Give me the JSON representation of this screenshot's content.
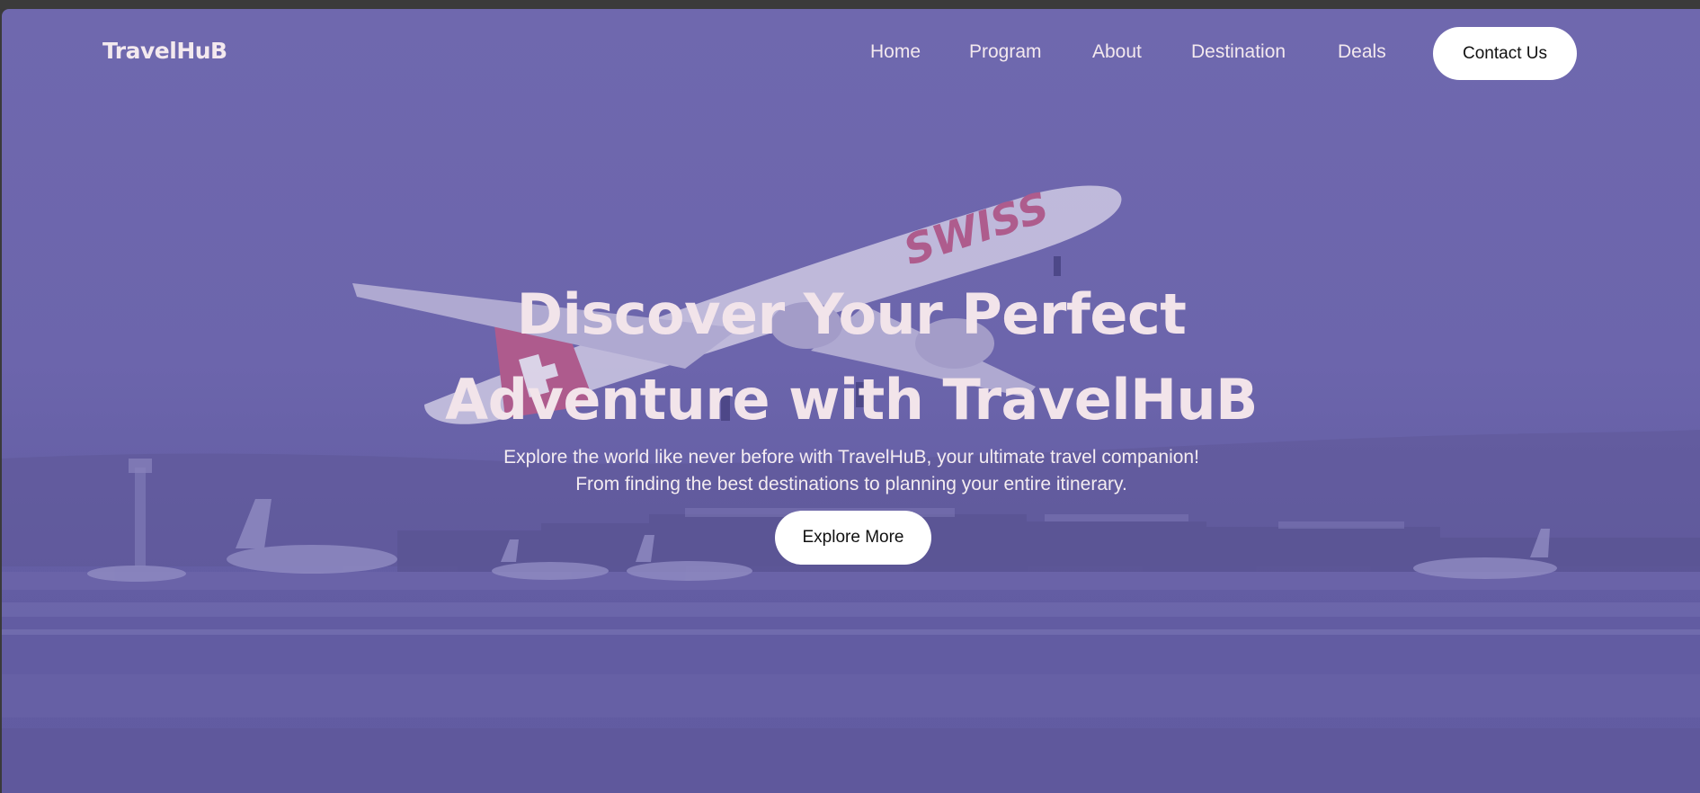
{
  "brand": {
    "logo_text": "TravelHuB"
  },
  "nav": {
    "items": [
      {
        "label": "Home"
      },
      {
        "label": "Program"
      },
      {
        "label": "About"
      },
      {
        "label": "Destination"
      },
      {
        "label": "Deals"
      }
    ],
    "contact_label": "Contact Us"
  },
  "hero": {
    "headline_line1": "Discover Your Perfect",
    "headline_line2": "Adventure with TravelHuB",
    "subtext_line1": "Explore the world like never before with TravelHuB, your ultimate travel companion!",
    "subtext_line2": "From finding the best destinations to planning your entire itinerary.",
    "cta_label": "Explore More",
    "background_image": {
      "airline_livery_text": "SWISS"
    }
  },
  "colors": {
    "overlay": "#6c65ac",
    "text_light": "#f2e4ea",
    "button_bg": "#ffffff",
    "button_text": "#111111",
    "window_frame": "#3b3b3b"
  }
}
